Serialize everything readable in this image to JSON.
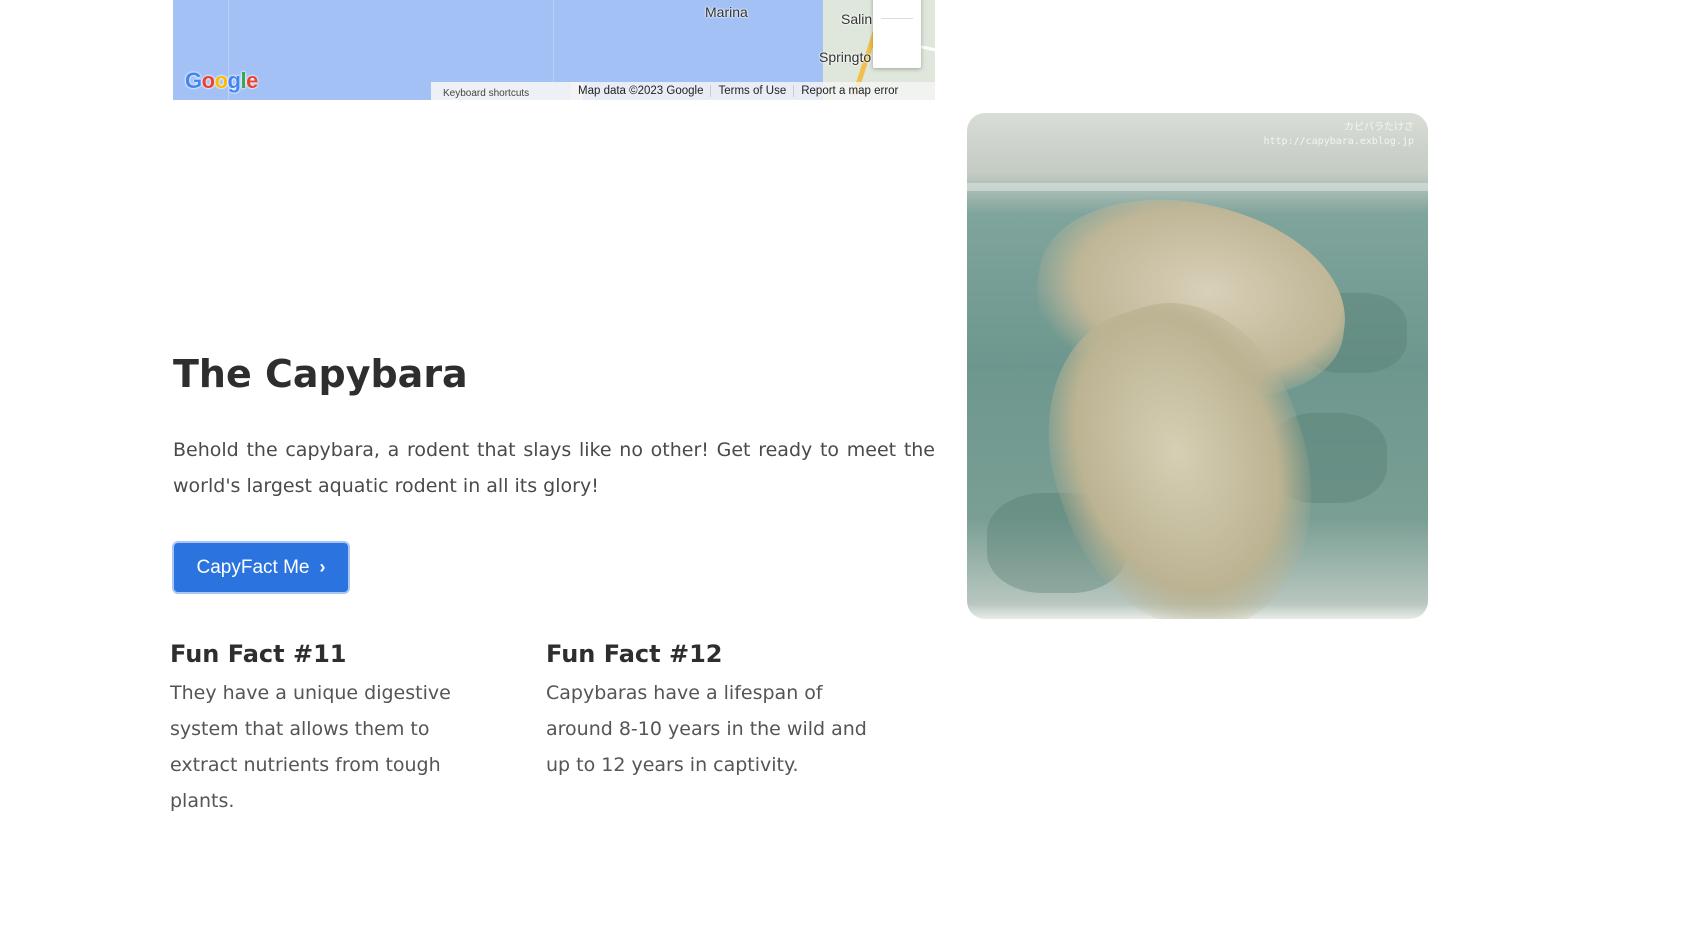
{
  "map": {
    "labels": {
      "marina": "Marina",
      "salinas": "Salin",
      "springtown": "Springto"
    },
    "logo_letters": [
      "G",
      "o",
      "o",
      "g",
      "l",
      "e"
    ],
    "keyboard_shortcuts": "Keyboard shortcuts",
    "footer": {
      "map_data": "Map data ©2023 Google",
      "terms": "Terms of Use",
      "report": "Report a map error"
    }
  },
  "hero": {
    "title": "The Capybara",
    "intro": "Behold the capybara, a rodent that slays like no other! Get ready to meet the world's largest aquatic rodent in all its glory!",
    "cta_label": "CapyFact Me",
    "cta_icon": "chevron-right-icon"
  },
  "facts": [
    {
      "title": "Fun Fact #11",
      "text": "They have a unique digestive system that allows them to extract nutrients from tough plants."
    },
    {
      "title": "Fun Fact #12",
      "text": "Capybaras have a lifespan of around 8-10 years in the wild and up to 12 years in captivity."
    }
  ],
  "photo": {
    "watermark_line1": "カピバラたけさ",
    "watermark_line2": "http://capybara.exblog.jp"
  },
  "colors": {
    "cta_bg": "#2b73de",
    "map_water": "#a3c1f4",
    "heading": "#2e2e2e"
  }
}
